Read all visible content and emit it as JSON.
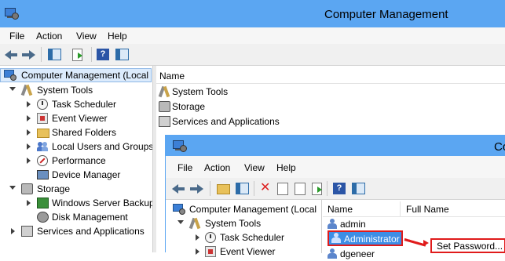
{
  "window": {
    "title": "Computer Management"
  },
  "menu": [
    "File",
    "Action",
    "View",
    "Help"
  ],
  "toolbar": {
    "icons": [
      "back-arrow-icon",
      "forward-arrow-icon",
      "show-hide-console-tree-icon",
      "export-list-icon",
      "help-icon",
      "show-hide-action-pane-icon"
    ]
  },
  "tree": {
    "root": "Computer Management (Local",
    "items": [
      {
        "label": "System Tools",
        "icon": "tools-icon"
      },
      {
        "label": "Task Scheduler",
        "icon": "clock-icon"
      },
      {
        "label": "Event Viewer",
        "icon": "event-viewer-icon"
      },
      {
        "label": "Shared Folders",
        "icon": "shared-folder-icon"
      },
      {
        "label": "Local Users and Groups",
        "icon": "users-icon"
      },
      {
        "label": "Performance",
        "icon": "performance-icon"
      },
      {
        "label": "Device Manager",
        "icon": "device-manager-icon"
      },
      {
        "label": "Storage",
        "icon": "storage-icon"
      },
      {
        "label": "Windows Server Backup",
        "icon": "backup-icon"
      },
      {
        "label": "Disk Management",
        "icon": "disk-icon"
      },
      {
        "label": "Services and Applications",
        "icon": "services-icon"
      }
    ]
  },
  "list": {
    "header": "Name",
    "items": [
      "System Tools",
      "Storage",
      "Services and Applications"
    ]
  },
  "inner": {
    "title": "Co",
    "menu": [
      "File",
      "Action",
      "View",
      "Help"
    ],
    "tree": {
      "root": "Computer Management (Local",
      "items": [
        "System Tools",
        "Task Scheduler",
        "Event Viewer"
      ]
    },
    "columns": [
      "Name",
      "Full Name"
    ],
    "users": [
      "admin",
      "Administrator",
      "dgeneer"
    ],
    "context_item": "Set Password..."
  },
  "colors": {
    "titlebar": "#5ba6f2",
    "selection": "#3d8ee6",
    "highlight": "#e01b1b"
  }
}
